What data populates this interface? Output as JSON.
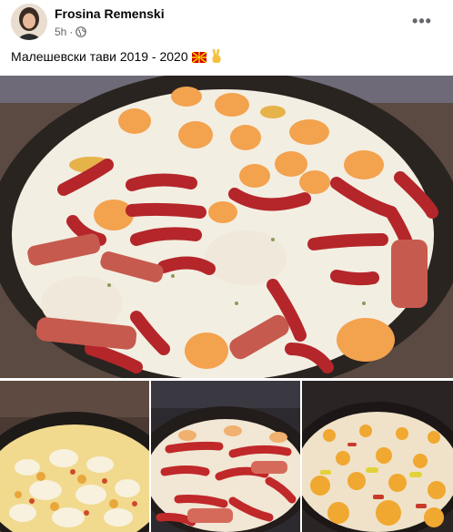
{
  "post": {
    "author_name": "Frosina Remenski",
    "time_ago": "5h",
    "separator": "·",
    "privacy_icon": "globe-icon",
    "more_icon": "ellipsis-icon",
    "more_label": "•••",
    "caption": "Малешевски тави 2019 - 2020",
    "caption_emoji": [
      "macedonia-flag-icon",
      "victory-hand-icon"
    ]
  },
  "photos": [
    {
      "subject": "pan of fried eggs with sausages and bacon"
    },
    {
      "subject": "pan of scrambled eggs"
    },
    {
      "subject": "pan of eggs with sausages"
    },
    {
      "subject": "pan of fried eggs with peppers"
    }
  ],
  "colors": {
    "name": "#050505",
    "meta": "#65676b",
    "pan": "#2a2420",
    "egg_white": "#f3eee2",
    "yolk": "#f3a24e",
    "sausage": "#b4262a"
  }
}
